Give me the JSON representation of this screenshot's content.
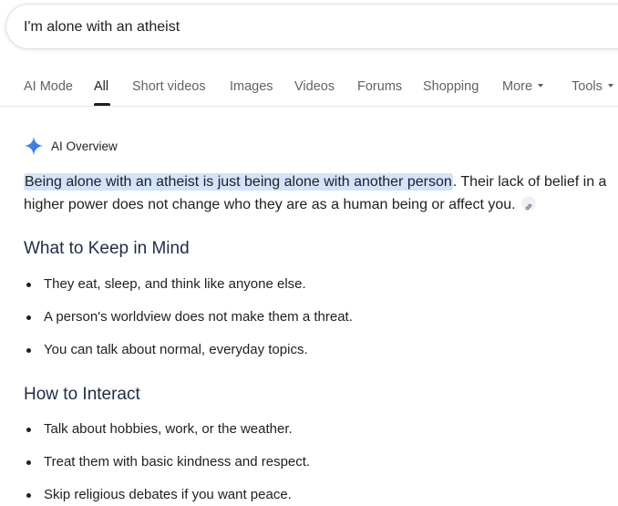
{
  "search": {
    "query": "I'm alone with an atheist"
  },
  "tabs": [
    {
      "label": "AI Mode"
    },
    {
      "label": "All"
    },
    {
      "label": "Short videos"
    },
    {
      "label": "Images"
    },
    {
      "label": "Videos"
    },
    {
      "label": "Forums"
    },
    {
      "label": "Shopping"
    },
    {
      "label": "More"
    },
    {
      "label": "Tools"
    }
  ],
  "active_tab": "All",
  "ai_overview": {
    "title": "AI Overview",
    "summary_highlight": "Being alone with an atheist is just being alone with another person",
    "summary_rest": ". Their lack of belief in a higher power does not change who they are as a human being or affect you.",
    "highlight_color": "#d3e3fd"
  },
  "sections": [
    {
      "heading": "What to Keep in Mind",
      "items": [
        "They eat, sleep, and think like anyone else.",
        "A person's worldview does not make them a threat.",
        "You can talk about normal, everyday topics."
      ]
    },
    {
      "heading": "How to Interact",
      "items": [
        "Talk about hobbies, work, or the weather.",
        "Treat them with basic kindness and respect.",
        "Skip religious debates if you want peace."
      ]
    }
  ],
  "colors": {
    "accent_blue": "#4285f4",
    "heading": "#1f2c46",
    "tab_inactive": "#5f6368"
  }
}
